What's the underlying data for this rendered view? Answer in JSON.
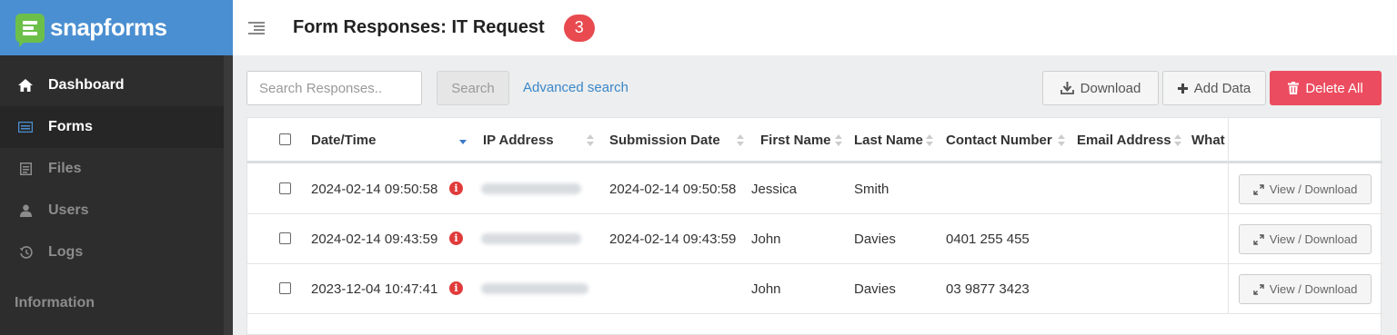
{
  "brand": {
    "name": "snapforms",
    "icon": "snapforms-logo-icon"
  },
  "sidebar": {
    "items": [
      {
        "label": "Dashboard",
        "icon": "home-icon"
      },
      {
        "label": "Forms",
        "icon": "forms-icon"
      },
      {
        "label": "Files",
        "icon": "files-icon"
      },
      {
        "label": "Users",
        "icon": "user-icon"
      },
      {
        "label": "Logs",
        "icon": "history-icon"
      }
    ],
    "section_label": "Information"
  },
  "header": {
    "title": "Form Responses: IT Request",
    "badge": "3"
  },
  "toolbar": {
    "search_placeholder": "Search Responses..",
    "search_label": "Search",
    "advanced_label": "Advanced search",
    "download_label": "Download",
    "add_label": "Add Data",
    "delete_label": "Delete All"
  },
  "colors": {
    "brand_bar": "#4a8fd1",
    "sidebar": "#2d2d2d",
    "danger": "#ec4c5f",
    "link": "#3b87c8"
  },
  "table": {
    "columns": [
      "Date/Time",
      "IP Address",
      "Submission Date",
      "First Name",
      "Last Name",
      "Contact Number",
      "Email Address",
      "What"
    ],
    "sorted_column": "Date/Time",
    "sort_direction": "desc",
    "rows": [
      {
        "datetime": "2024-02-14 09:50:58",
        "submission_date": "2024-02-14 09:50:58",
        "first_name": "Jessica",
        "last_name": "Smith",
        "contact": "",
        "action": "View / Download"
      },
      {
        "datetime": "2024-02-14 09:43:59",
        "submission_date": "2024-02-14 09:43:59",
        "first_name": "John",
        "last_name": "Davies",
        "contact": "0401 255 455",
        "action": "View / Download"
      },
      {
        "datetime": "2023-12-04 10:47:41",
        "submission_date": "",
        "first_name": "John",
        "last_name": "Davies",
        "contact": "03 9877 3423",
        "action": "View / Download"
      }
    ]
  }
}
